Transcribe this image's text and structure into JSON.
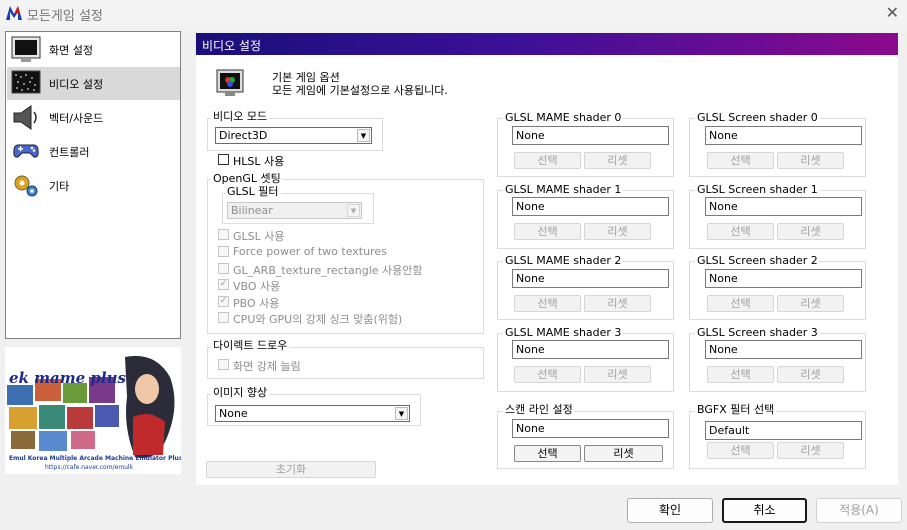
{
  "window": {
    "title": "모든게임 설정"
  },
  "sidebar": {
    "items": [
      {
        "label": "화면 설정",
        "icon": "monitor-icon"
      },
      {
        "label": "비디오 설정",
        "icon": "video-screen-icon"
      },
      {
        "label": "벡터/사운드",
        "icon": "speaker-icon"
      },
      {
        "label": "컨트롤러",
        "icon": "gamepad-icon"
      },
      {
        "label": "기타",
        "icon": "gear-icon"
      }
    ]
  },
  "banner": {
    "logo": "ek mame plus",
    "caption": "Emul Korea Multiple Arcade Machine Emulator Plus",
    "url": "https://cafe.naver.com/emulk"
  },
  "panel": {
    "title": "비디오 설정",
    "desc_line1": "기본 게임 옵션",
    "desc_line2": "모든 게임에 기본설정으로 사용됩니다."
  },
  "video_mode": {
    "label": "비디오 모드",
    "value": "Direct3D"
  },
  "hlsl": {
    "label": "HLSL 사용",
    "checked": false
  },
  "opengl": {
    "label": "OpenGL 셋팅",
    "filter_label": "GLSL 필터",
    "filter_value": "Bilinear",
    "options": [
      {
        "label": "GLSL 사용",
        "checked": false
      },
      {
        "label": "Force power of two textures",
        "checked": false
      },
      {
        "label": "GL_ARB_texture_rectangle 사용안함",
        "checked": false
      },
      {
        "label": "VBO 사용",
        "checked": true
      },
      {
        "label": "PBO 사용",
        "checked": true
      },
      {
        "label": "CPU와 GPU의 강제 싱크 맞춤(위험)",
        "checked": false
      }
    ]
  },
  "directdraw": {
    "label": "다이렉트 드로우",
    "option": "화면 강제 늘림"
  },
  "image_enhance": {
    "label": "이미지 향상",
    "value": "None"
  },
  "reset_button": "초기화",
  "mame_shaders": [
    {
      "label": "GLSL MAME shader 0",
      "value": "None"
    },
    {
      "label": "GLSL MAME shader 1",
      "value": "None"
    },
    {
      "label": "GLSL MAME shader 2",
      "value": "None"
    },
    {
      "label": "GLSL MAME shader 3",
      "value": "None"
    }
  ],
  "screen_shaders": [
    {
      "label": "GLSL Screen shader 0",
      "value": "None"
    },
    {
      "label": "GLSL Screen shader 1",
      "value": "None"
    },
    {
      "label": "GLSL Screen shader 2",
      "value": "None"
    },
    {
      "label": "GLSL Screen shader 3",
      "value": "None"
    }
  ],
  "scanline": {
    "label": "스캔 라인 설정",
    "value": "None"
  },
  "bgfx": {
    "label": "BGFX 필터 선택",
    "value": "Default"
  },
  "select_label": "선택",
  "reset_label": "리셋",
  "dialog_buttons": {
    "ok": "확인",
    "cancel": "취소",
    "apply": "적용(A)"
  }
}
